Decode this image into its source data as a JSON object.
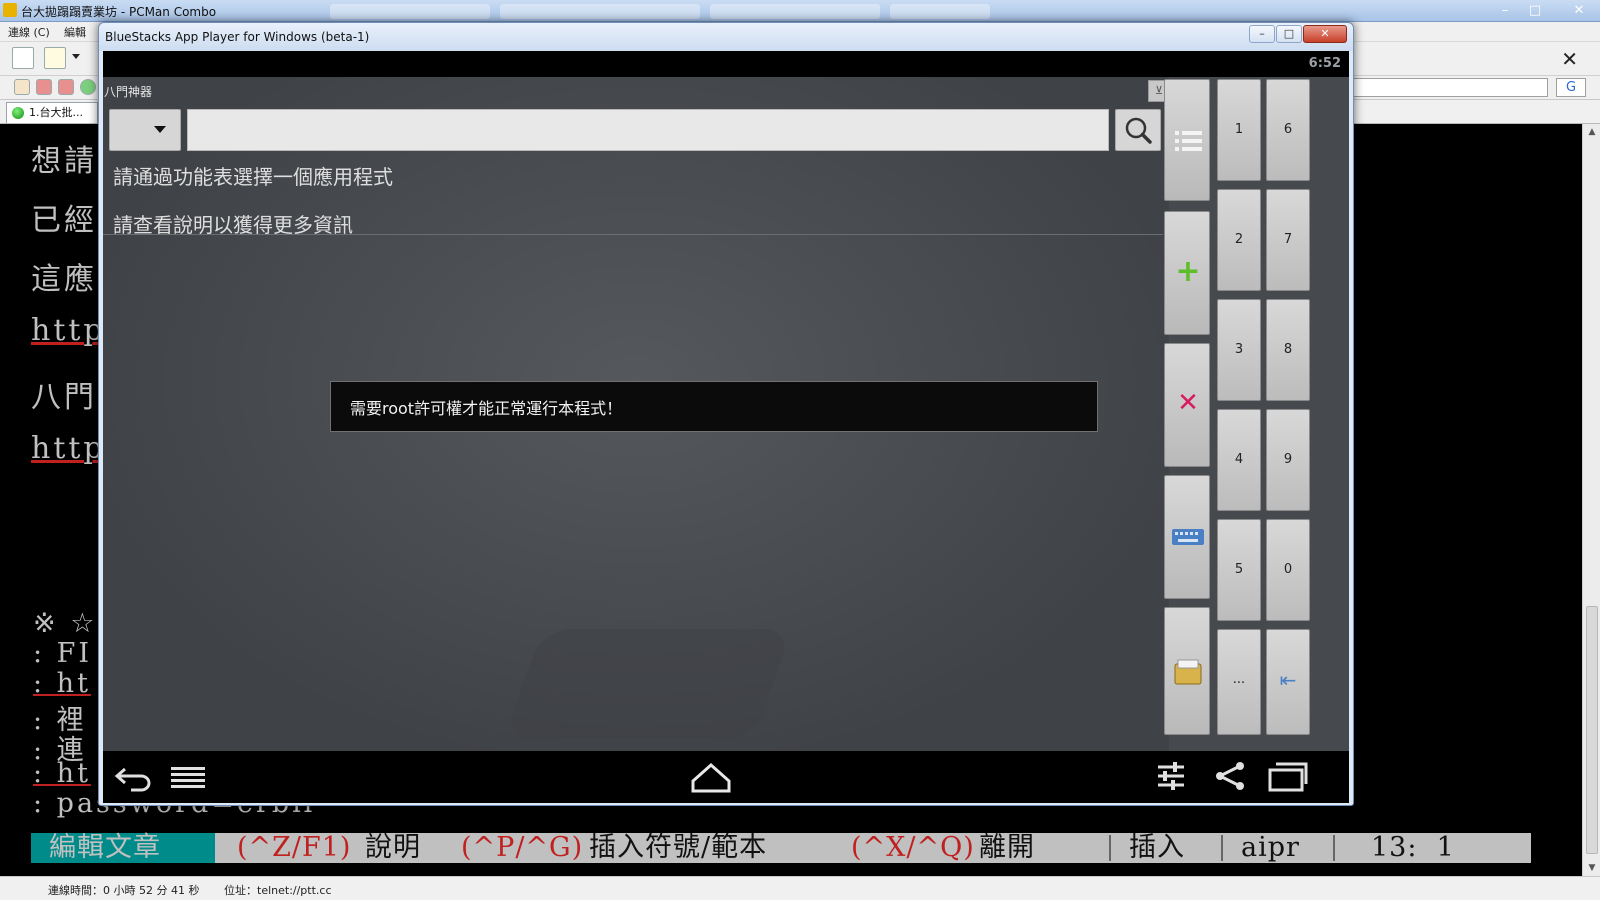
{
  "pcman": {
    "title": "台大拋蹋蹋賣業坊 - PCMan Combo",
    "menu": [
      "連線 (C)",
      "編輯"
    ],
    "tab_label": "1.台大批...",
    "window_controls": {
      "minimize": "–",
      "maximize": "□",
      "close": "✕"
    },
    "toolbar_close": "✕",
    "search_engine_glyph": "G",
    "terminal_lines": [
      {
        "text": "想請",
        "link": false
      },
      {
        "text": "已經",
        "link": false
      },
      {
        "text": "這應",
        "link": false
      },
      {
        "text": "http",
        "link": true
      },
      {
        "text": "八門",
        "link": false
      },
      {
        "text": "http",
        "link": true
      }
    ],
    "terminal_small_lines": [
      {
        "text": "※  ☆",
        "link": false
      },
      {
        "text": ":  FI",
        "link": false
      },
      {
        "text": ":  ht",
        "link": true
      },
      {
        "text": ":  裡",
        "link": false
      },
      {
        "text": ":  連",
        "link": false
      },
      {
        "text": ":  ht",
        "link": true
      },
      {
        "text": ":  password=erbil",
        "link": false
      }
    ],
    "status_bar": {
      "mode": "編輯文章",
      "help_key": "(^Z/F1)",
      "help_text": "說明",
      "insert_key": "(^P/^G)",
      "insert_text": "插入符號/範本",
      "quit_key": "(^X/^Q)",
      "quit_text": "離開",
      "insert_mode": "插入",
      "input_mode": "aipr",
      "cursor_pos": "13:  1"
    },
    "bottom_status": {
      "connect_time": "連線時間：0 小時 52 分 41 秒",
      "address": "位址：telnet://ptt.cc"
    },
    "colors": {
      "status_mode_bg": "#008b8b",
      "status_key": "#c02020",
      "status_bg": "#c0c0c0"
    }
  },
  "bluestacks": {
    "title": "BlueStacks App Player for Windows (beta-1)",
    "clock": "6:52",
    "window_controls": {
      "minimize": "–",
      "maximize": "□",
      "close": "✕"
    },
    "app": {
      "name": "八門神器",
      "search_placeholder": "",
      "message_1": "請通過功能表選擇一個應用程式",
      "message_2": "請查看說明以獲得更多資訊",
      "toast": "需要root許可權才能正常運行本程式！"
    },
    "tools": [
      {
        "name": "list-icon",
        "glyph": "≡",
        "color": "#f4f4f4"
      },
      {
        "name": "plus-icon",
        "glyph": "+",
        "color": "#5cbf2a"
      },
      {
        "name": "close-icon",
        "glyph": "✕",
        "color": "#d81b60"
      },
      {
        "name": "keyboard-icon",
        "glyph": "⌨",
        "color": "#4a7fc4"
      },
      {
        "name": "folder-icon",
        "glyph": "▤",
        "color": "#d8b24a"
      }
    ],
    "numpad_left": [
      "1",
      "2",
      "3",
      "4",
      "5",
      "..."
    ],
    "numpad_right": [
      "6",
      "7",
      "8",
      "9",
      "0",
      "⇤"
    ],
    "nav": [
      "back-icon",
      "menu-icon",
      "home-icon",
      "settings-icon",
      "share-icon",
      "recent-apps-icon"
    ]
  }
}
